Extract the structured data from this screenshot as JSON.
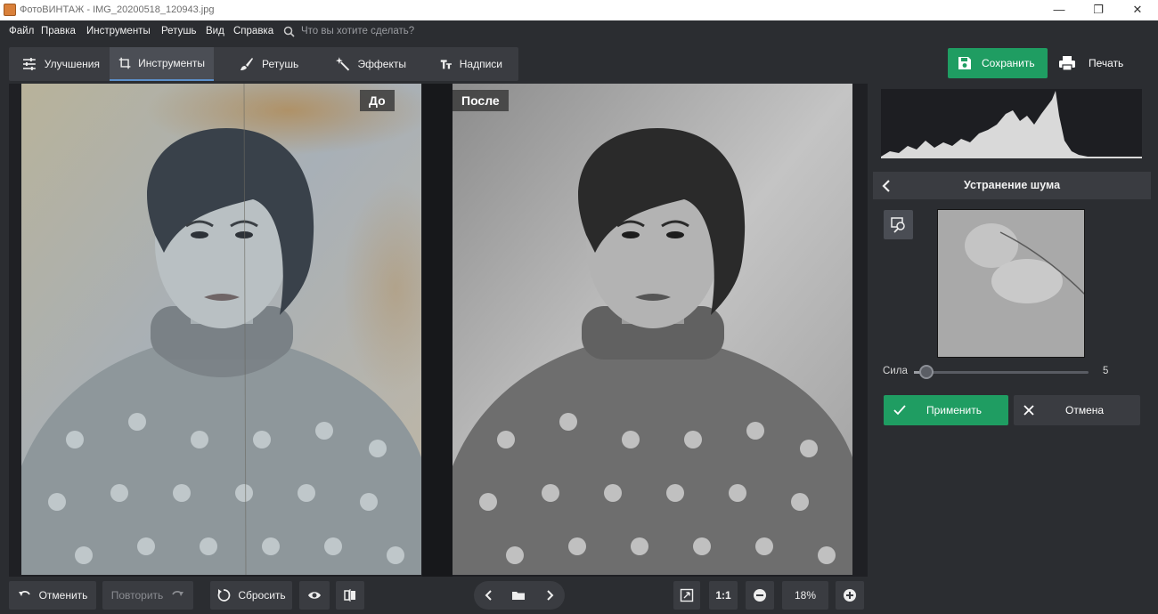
{
  "window": {
    "title": "ФотоВИНТАЖ - IMG_20200518_120943.jpg",
    "controls": [
      "minimize",
      "maximize",
      "close"
    ]
  },
  "menu": {
    "items": [
      "Файл",
      "Правка",
      "Инструменты",
      "Ретушь",
      "Вид",
      "Справка"
    ],
    "search_placeholder": "Что вы хотите сделать?"
  },
  "tabs": [
    {
      "label": "Улучшения",
      "icon": "sliders-icon"
    },
    {
      "label": "Инструменты",
      "icon": "crop-icon",
      "active": true
    },
    {
      "label": "Ретушь",
      "icon": "brush-icon"
    },
    {
      "label": "Эффекты",
      "icon": "magic-wand-icon"
    },
    {
      "label": "Надписи",
      "icon": "text-icon"
    }
  ],
  "actions": {
    "save_label": "Сохранить",
    "print_label": "Печать"
  },
  "photos": {
    "before_label": "До",
    "after_label": "После"
  },
  "bottom": {
    "undo_label": "Отменить",
    "redo_label": "Повторить",
    "reset_label": "Сбросить",
    "zoom_one_to_one": "1:1",
    "zoom_level": "18%"
  },
  "panel": {
    "title": "Устранение шума",
    "strength_label": "Сила",
    "strength_value": "5",
    "strength_fraction": 0.07,
    "apply_label": "Применить",
    "cancel_label": "Отмена"
  },
  "colors": {
    "accent_green": "#1f9d62",
    "background": "#2b2d31",
    "active_tab_underline": "#5c8fc9"
  }
}
